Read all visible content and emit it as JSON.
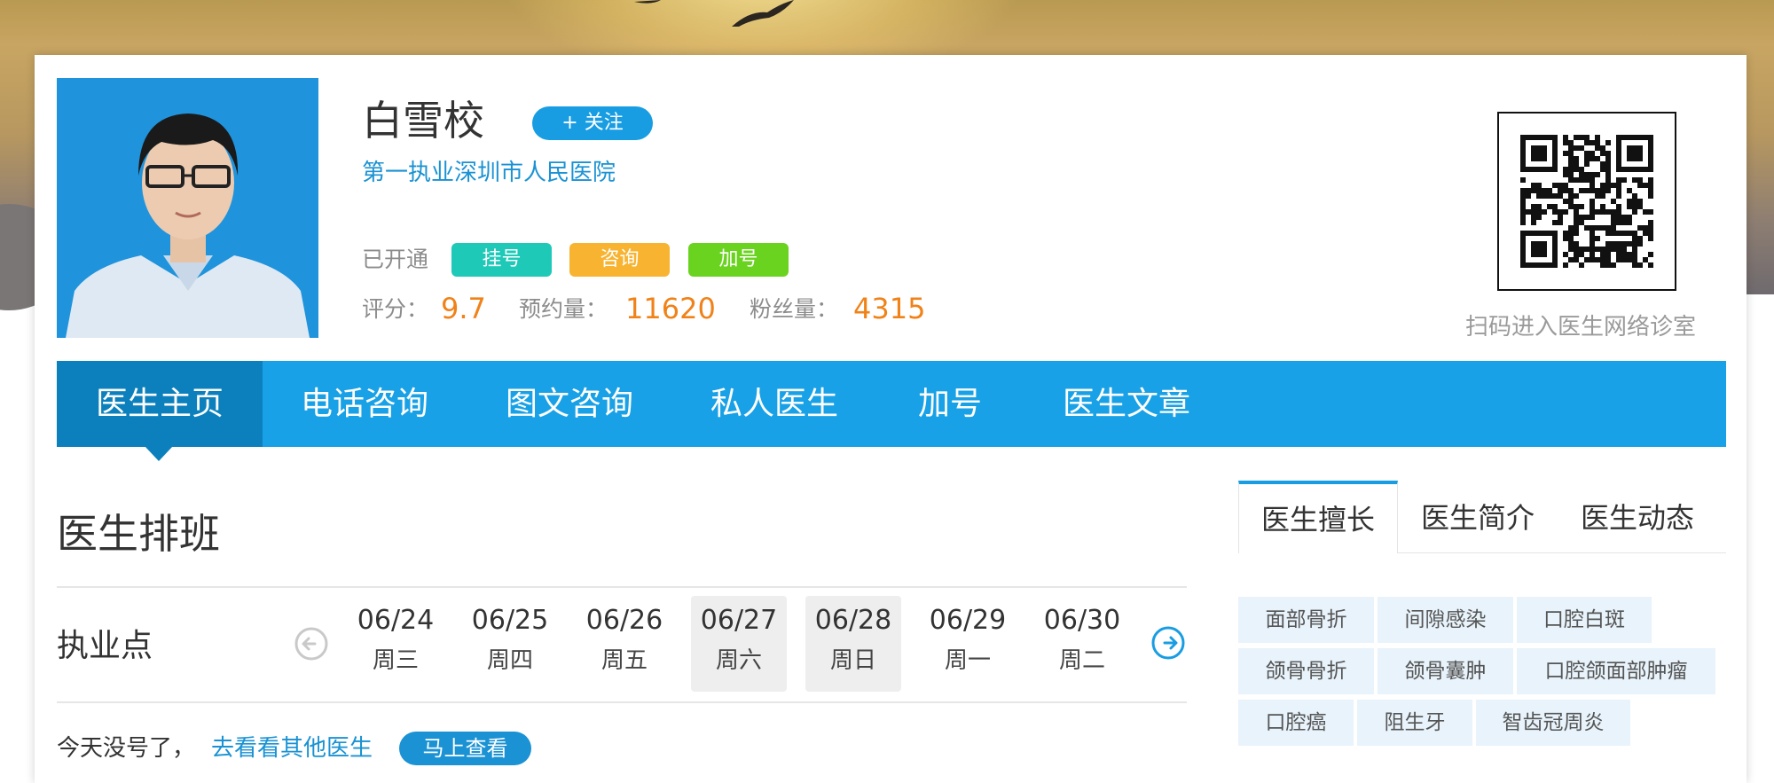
{
  "doctor": {
    "name": "白雪校",
    "follow_label": "+ 关注",
    "hospital": "第一执业深圳市人民医院",
    "opened_label": "已开通",
    "services": [
      {
        "label": "挂号",
        "color": "#1ec9b8"
      },
      {
        "label": "咨询",
        "color": "#f8b330"
      },
      {
        "label": "加号",
        "color": "#6ad31f"
      }
    ],
    "stats": {
      "rating_label": "评分：",
      "rating": "9.7",
      "bookings_label": "预约量：",
      "bookings": "11620",
      "fans_label": "粉丝量：",
      "fans": "4315"
    },
    "qr_caption": "扫码进入医生网络诊室"
  },
  "nav": {
    "items": [
      "医生主页",
      "电话咨询",
      "图文咨询",
      "私人医生",
      "加号",
      "医生文章"
    ],
    "active_index": 0
  },
  "schedule": {
    "title": "医生排班",
    "location_label": "执业点",
    "days": [
      {
        "date": "06/24",
        "weekday": "周三",
        "weekend": false
      },
      {
        "date": "06/25",
        "weekday": "周四",
        "weekend": false
      },
      {
        "date": "06/26",
        "weekday": "周五",
        "weekend": false
      },
      {
        "date": "06/27",
        "weekday": "周六",
        "weekend": true
      },
      {
        "date": "06/28",
        "weekday": "周日",
        "weekend": true
      },
      {
        "date": "06/29",
        "weekday": "周一",
        "weekend": false
      },
      {
        "date": "06/30",
        "weekday": "周二",
        "weekend": false
      }
    ],
    "no_slot_text": "今天没号了，",
    "other_link": "去看看其他医生",
    "view_button": "马上查看"
  },
  "right_tabs": {
    "items": [
      "医生擅长",
      "医生简介",
      "医生动态"
    ],
    "active_index": 0
  },
  "skills": [
    "面部骨折",
    "间隙感染",
    "口腔白斑",
    "颌骨骨折",
    "颌骨囊肿",
    "口腔颌面部肿瘤",
    "口腔癌",
    "阻生牙",
    "智齿冠周炎"
  ],
  "colors": {
    "accent": "#18a1e6",
    "nav_active": "#0c80bc",
    "stat_orange": "#f08219",
    "link_blue": "#1a92d3"
  }
}
